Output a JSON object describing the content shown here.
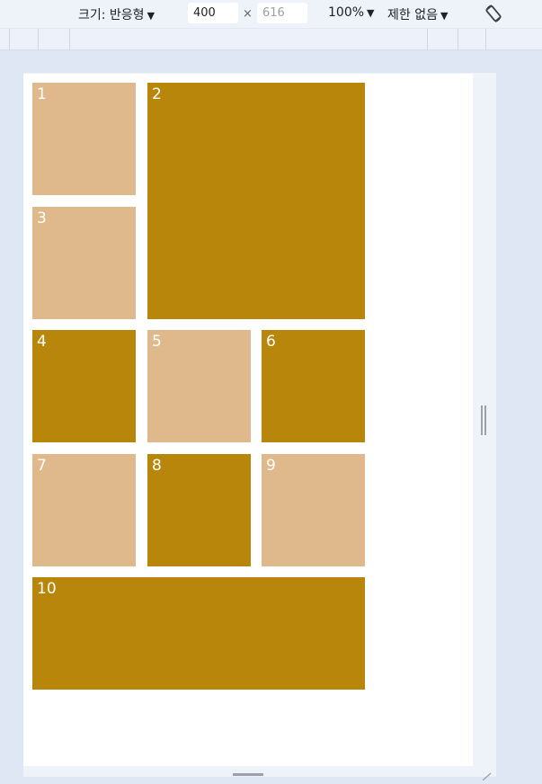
{
  "toolbar": {
    "size_label": "크기: 반응형",
    "width_value": "400",
    "times": "×",
    "height_placeholder": "616",
    "zoom": "100%",
    "throttle": "제한 없음",
    "caret": "▼"
  },
  "icons": {
    "rotate": "rotate-icon",
    "caret": "caret-down-icon"
  },
  "colors": {
    "light_tile": "#dfb98b",
    "dark_tile": "#b8860b",
    "page_bg": "#dfe6f4",
    "viewport_bg": "#ffffff"
  },
  "grid": {
    "items": [
      {
        "label": "1",
        "tone": "light"
      },
      {
        "label": "2",
        "tone": "dark"
      },
      {
        "label": "3",
        "tone": "light"
      },
      {
        "label": "4",
        "tone": "dark"
      },
      {
        "label": "5",
        "tone": "light"
      },
      {
        "label": "6",
        "tone": "dark"
      },
      {
        "label": "7",
        "tone": "light"
      },
      {
        "label": "8",
        "tone": "dark"
      },
      {
        "label": "9",
        "tone": "light"
      },
      {
        "label": "10",
        "tone": "dark"
      }
    ]
  }
}
